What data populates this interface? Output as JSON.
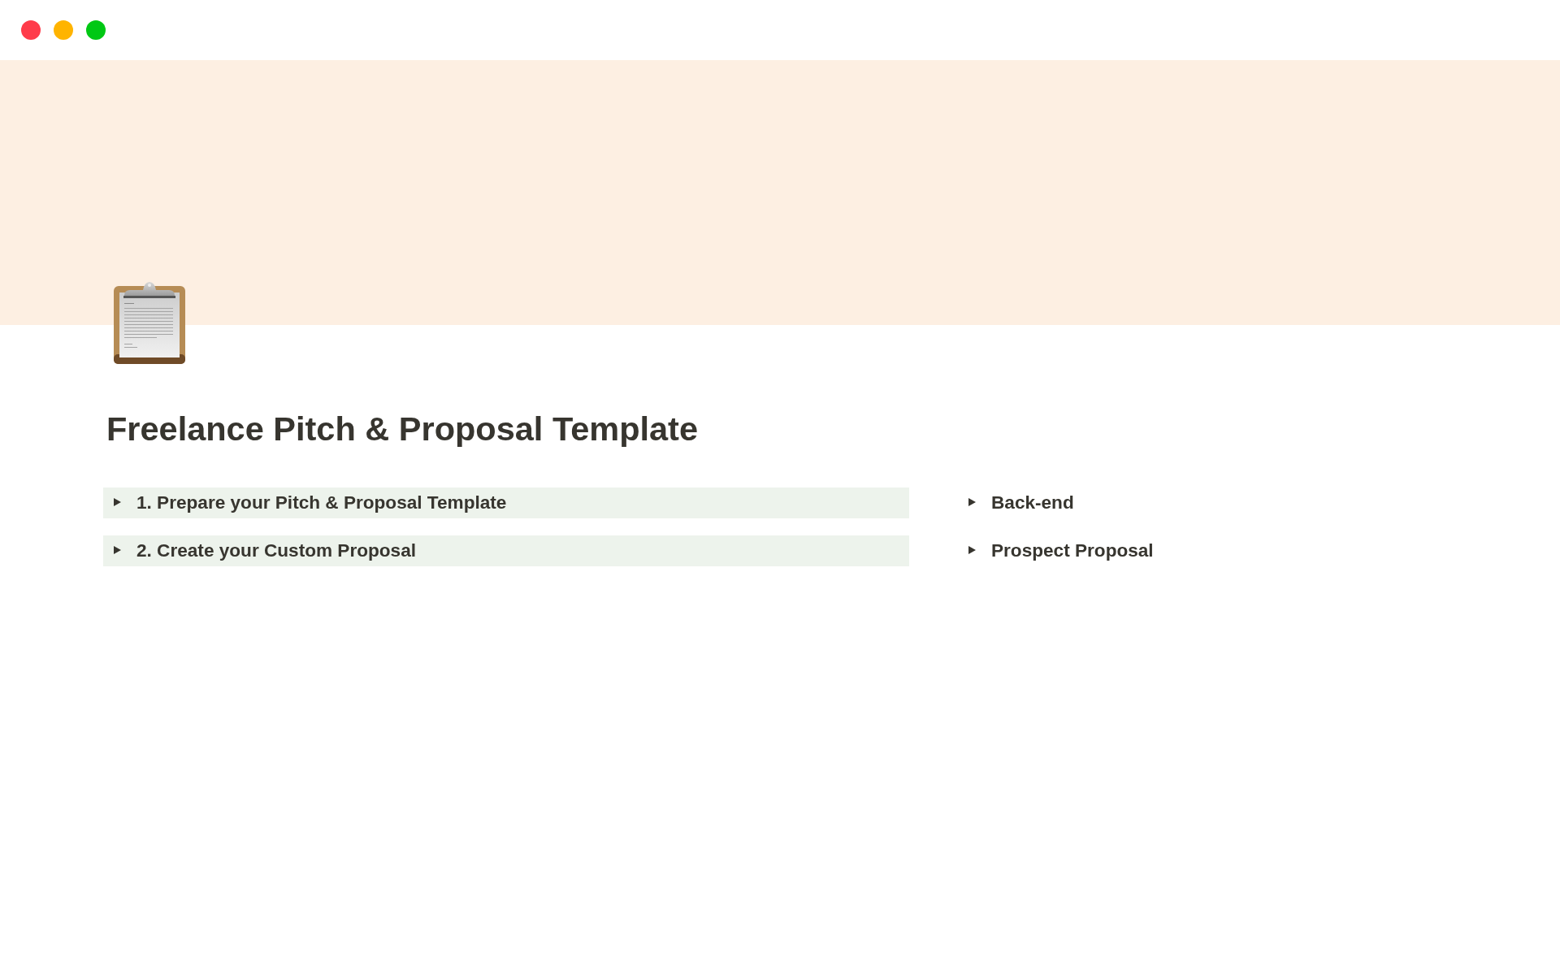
{
  "window_buttons": [
    {
      "color": "#ff3b4a"
    },
    {
      "color": "#ffb400"
    },
    {
      "color": "#00c814"
    }
  ],
  "title": "Freelance Pitch & Proposal Template",
  "columns": [
    {
      "toggles": [
        {
          "label": "1. Prepare your Pitch & Proposal Template",
          "expanded": false,
          "color": "#edf3ec"
        },
        {
          "label": "2. Create your Custom Proposal",
          "expanded": false,
          "color": "#edf3ec"
        }
      ]
    },
    {
      "toggles": [
        {
          "label": "Back-end",
          "expanded": false
        },
        {
          "label": "Prospect Proposal",
          "expanded": false
        }
      ]
    }
  ]
}
